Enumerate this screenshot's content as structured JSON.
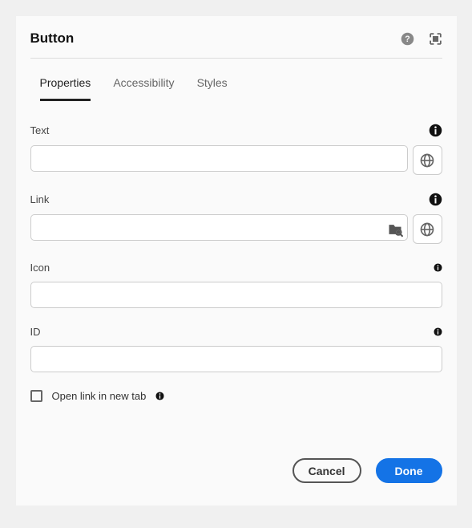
{
  "header": {
    "title": "Button"
  },
  "tabs": {
    "items": [
      {
        "label": "Properties",
        "active": true
      },
      {
        "label": "Accessibility",
        "active": false
      },
      {
        "label": "Styles",
        "active": false
      }
    ]
  },
  "fields": {
    "text": {
      "label": "Text",
      "value": ""
    },
    "link": {
      "label": "Link",
      "value": ""
    },
    "icon": {
      "label": "Icon",
      "value": ""
    },
    "id": {
      "label": "ID",
      "value": ""
    }
  },
  "checkbox": {
    "open_new_tab": {
      "label": "Open link in new tab",
      "checked": false
    }
  },
  "footer": {
    "cancel": "Cancel",
    "done": "Done"
  }
}
